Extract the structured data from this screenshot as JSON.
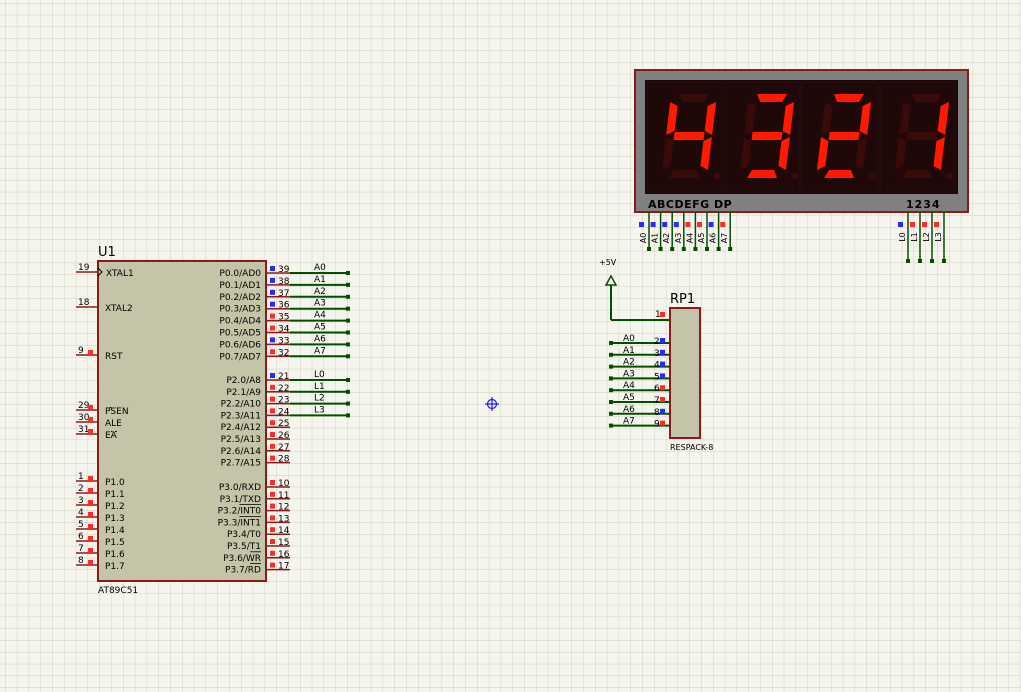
{
  "mcu": {
    "ref": "U1",
    "part": "AT89C51",
    "left_pins": [
      {
        "num": "19",
        "name": "XTAL1",
        "clock": true
      },
      {
        "num": "18",
        "name": "XTAL2"
      },
      {
        "num": "9",
        "name": "RST"
      },
      {
        "num": "29",
        "name": "PSEN",
        "overline": true
      },
      {
        "num": "30",
        "name": "ALE"
      },
      {
        "num": "31",
        "name": "EA",
        "overline": true
      },
      {
        "num": "1",
        "name": "P1.0"
      },
      {
        "num": "2",
        "name": "P1.1"
      },
      {
        "num": "3",
        "name": "P1.2"
      },
      {
        "num": "4",
        "name": "P1.3"
      },
      {
        "num": "5",
        "name": "P1.4"
      },
      {
        "num": "6",
        "name": "P1.5"
      },
      {
        "num": "7",
        "name": "P1.6"
      },
      {
        "num": "8",
        "name": "P1.7"
      }
    ],
    "right_pins": [
      {
        "num": "39",
        "name": "P0.0/AD0",
        "net": "A0",
        "state": "low"
      },
      {
        "num": "38",
        "name": "P0.1/AD1",
        "net": "A1",
        "state": "low"
      },
      {
        "num": "37",
        "name": "P0.2/AD2",
        "net": "A2",
        "state": "low"
      },
      {
        "num": "36",
        "name": "P0.3/AD3",
        "net": "A3",
        "state": "low"
      },
      {
        "num": "35",
        "name": "P0.4/AD4",
        "net": "A4",
        "state": "high"
      },
      {
        "num": "34",
        "name": "P0.5/AD5",
        "net": "A5",
        "state": "high"
      },
      {
        "num": "33",
        "name": "P0.6/AD6",
        "net": "A6",
        "state": "low"
      },
      {
        "num": "32",
        "name": "P0.7/AD7",
        "net": "A7",
        "state": "high"
      },
      {
        "num": "21",
        "name": "P2.0/A8",
        "net": "L0",
        "state": "low"
      },
      {
        "num": "22",
        "name": "P2.1/A9",
        "net": "L1",
        "state": "high"
      },
      {
        "num": "23",
        "name": "P2.2/A10",
        "net": "L2",
        "state": "high"
      },
      {
        "num": "24",
        "name": "P2.3/A11",
        "net": "L3",
        "state": "high"
      },
      {
        "num": "25",
        "name": "P2.4/A12",
        "net": "",
        "state": "high"
      },
      {
        "num": "26",
        "name": "P2.5/A13",
        "net": "",
        "state": "high"
      },
      {
        "num": "27",
        "name": "P2.6/A14",
        "net": "",
        "state": "high"
      },
      {
        "num": "28",
        "name": "P2.7/A15",
        "net": "",
        "state": "high"
      },
      {
        "num": "10",
        "name": "P3.0/RXD",
        "net": "",
        "state": "high"
      },
      {
        "num": "11",
        "name": "P3.1/TXD",
        "net": "",
        "state": "high"
      },
      {
        "num": "12",
        "name": "P3.2/INT0",
        "overline_part": "INT0",
        "net": "",
        "state": "high"
      },
      {
        "num": "13",
        "name": "P3.3/INT1",
        "overline_part": "INT1",
        "net": "",
        "state": "high"
      },
      {
        "num": "14",
        "name": "P3.4/T0",
        "net": "",
        "state": "high"
      },
      {
        "num": "15",
        "name": "P3.5/T1",
        "net": "",
        "state": "high"
      },
      {
        "num": "16",
        "name": "P3.6/WR",
        "overline_part": "WR",
        "net": "",
        "state": "high"
      },
      {
        "num": "17",
        "name": "P3.7/RD",
        "overline_part": "RD",
        "net": "",
        "state": "high"
      }
    ]
  },
  "display": {
    "digits": [
      "4",
      "3",
      "2",
      "1"
    ],
    "segment_label": "ABCDEFG DP",
    "digit_label": "1234",
    "segment_pins": [
      "A0",
      "A1",
      "A2",
      "A3",
      "A4",
      "A5",
      "A6",
      "A7"
    ],
    "segment_states": [
      "low",
      "low",
      "low",
      "low",
      "high",
      "high",
      "low",
      "high"
    ],
    "select_pins": [
      "L0",
      "L1",
      "L2",
      "L3"
    ],
    "select_states": [
      "low",
      "high",
      "high",
      "high"
    ]
  },
  "respack": {
    "ref": "RP1",
    "part": "RESPACK-8",
    "power": "+5V",
    "common_pin": "1",
    "pins": [
      {
        "num": "2",
        "net": "A0",
        "state": "low"
      },
      {
        "num": "3",
        "net": "A1",
        "state": "low"
      },
      {
        "num": "4",
        "net": "A2",
        "state": "low"
      },
      {
        "num": "5",
        "net": "A3",
        "state": "low"
      },
      {
        "num": "6",
        "net": "A4",
        "state": "high"
      },
      {
        "num": "7",
        "net": "A5",
        "state": "high"
      },
      {
        "num": "8",
        "net": "A6",
        "state": "low"
      },
      {
        "num": "9",
        "net": "A7",
        "state": "high"
      }
    ]
  },
  "colors": {
    "background": "#f5f5ee",
    "grid": "#cfcfbd",
    "body_fill": "#c4c4a8",
    "body_border": "#8b1a1a",
    "wire": "#005000",
    "state_high": "#ff2a2a",
    "state_low": "#2a2aff",
    "segment_on": "#ff1a00",
    "segment_off": "#3a0a0a",
    "display_bg": "#1a0707",
    "display_frame": "#808080"
  }
}
